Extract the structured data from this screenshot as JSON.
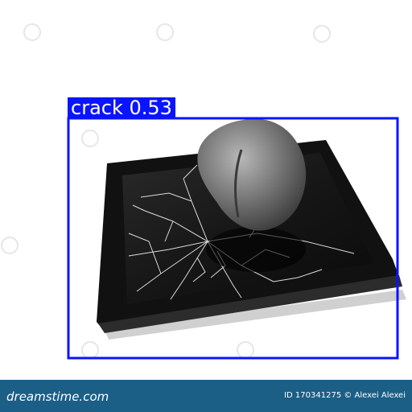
{
  "detection": {
    "class": "crack",
    "confidence": "0.53",
    "label": "crack 0.53",
    "box_color": "#0a14ff"
  },
  "watermark": {
    "brand": "dreamstime.com",
    "credit": "ID 170341275 © Alexei Alexei",
    "bar_color": "#1b5e86"
  },
  "subject": {
    "objects": [
      "tablet-with-cracked-screen",
      "rock"
    ]
  }
}
